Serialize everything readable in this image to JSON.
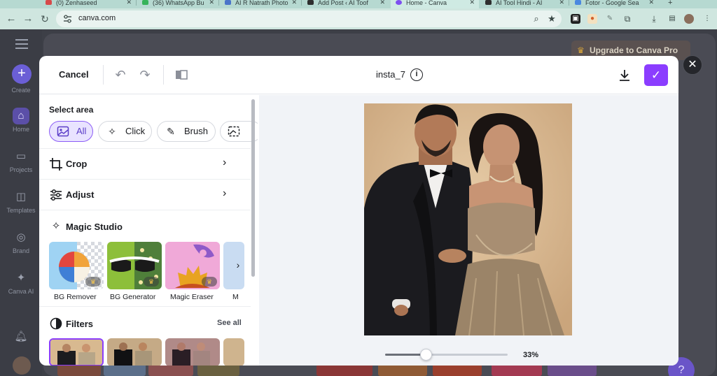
{
  "browser": {
    "tabs": [
      {
        "title": "(0) Zenhaseed",
        "active": false
      },
      {
        "title": "(36) WhatsApp Bu",
        "active": false
      },
      {
        "title": "AI R Natrath Photo",
        "active": false
      },
      {
        "title": "Add Post ‹ AI Toof",
        "active": false
      },
      {
        "title": "Home - Canva",
        "active": true
      },
      {
        "title": "AI Tool Hindi - AI",
        "active": false
      },
      {
        "title": "Fotor - Google Sea",
        "active": false
      }
    ],
    "url": "canva.com",
    "new_tab_icon": "plus-icon"
  },
  "canva": {
    "sidebar": {
      "items": [
        {
          "label": "Create",
          "icon": "plus-icon"
        },
        {
          "label": "Home",
          "icon": "home-icon"
        },
        {
          "label": "Projects",
          "icon": "folder-icon"
        },
        {
          "label": "Templates",
          "icon": "layout-icon"
        },
        {
          "label": "Brand",
          "icon": "brand-icon"
        },
        {
          "label": "Canva AI",
          "icon": "sparkle-icon"
        }
      ]
    },
    "upgrade_label": "Upgrade to Canva Pro",
    "help_label": "?",
    "close_label": "✕"
  },
  "editor": {
    "cancel_label": "Cancel",
    "doc_title": "insta_7",
    "info_label": "i",
    "select_area": {
      "title": "Select area",
      "chips": [
        {
          "label": "All",
          "icon": "image-icon",
          "active": true
        },
        {
          "label": "Click",
          "icon": "magic-click-icon",
          "active": false
        },
        {
          "label": "Brush",
          "icon": "brush-icon",
          "active": false
        },
        {
          "label": "",
          "icon": "image-select-icon",
          "active": false
        }
      ]
    },
    "rows": [
      {
        "label": "Crop",
        "icon": "crop-icon"
      },
      {
        "label": "Adjust",
        "icon": "sliders-icon"
      }
    ],
    "magic_studio": {
      "title": "Magic Studio",
      "tools": [
        {
          "label": "BG Remover"
        },
        {
          "label": "BG Generator"
        },
        {
          "label": "Magic Eraser"
        },
        {
          "label": "M"
        }
      ]
    },
    "filters": {
      "title": "Filters",
      "see_all": "See all"
    },
    "zoom": {
      "level": 33,
      "label": "33%"
    }
  },
  "colors": {
    "accent": "#8b3dff",
    "selected_chip_bg": "#e9e3ff",
    "canvas_bg": "#f1f3f7"
  }
}
